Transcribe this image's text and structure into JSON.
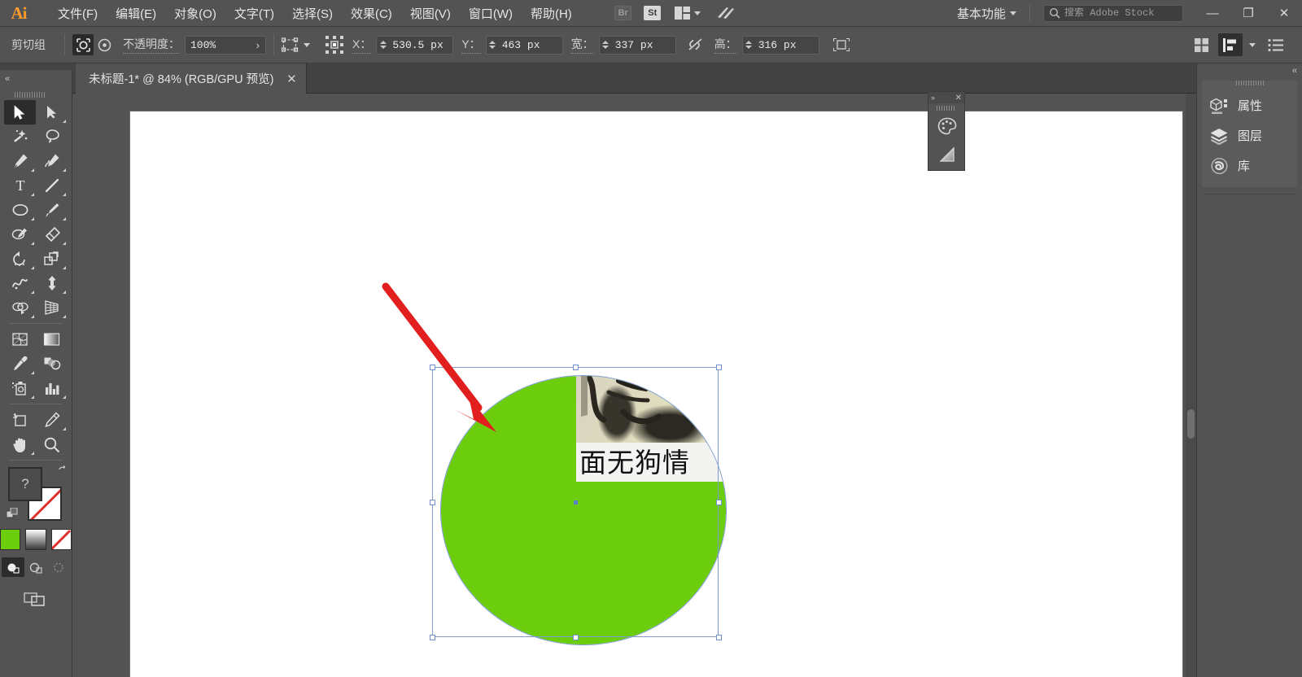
{
  "app": {
    "name": "Adobe Illustrator",
    "logo_text": "Ai"
  },
  "menubar": {
    "items": [
      {
        "label": "文件(F)",
        "name": "menu-file"
      },
      {
        "label": "编辑(E)",
        "name": "menu-edit"
      },
      {
        "label": "对象(O)",
        "name": "menu-object"
      },
      {
        "label": "文字(T)",
        "name": "menu-type"
      },
      {
        "label": "选择(S)",
        "name": "menu-select"
      },
      {
        "label": "效果(C)",
        "name": "menu-effect"
      },
      {
        "label": "视图(V)",
        "name": "menu-view"
      },
      {
        "label": "窗口(W)",
        "name": "menu-window"
      },
      {
        "label": "帮助(H)",
        "name": "menu-help"
      }
    ],
    "bridge_badge": "Br",
    "stock_badge": "St",
    "workspace": "基本功能",
    "search_placeholder": "搜索 Adobe Stock",
    "search_value": "",
    "window_minimize": "—",
    "window_restore": "❐",
    "window_close": "✕"
  },
  "controlbar": {
    "selection_label": "剪切组",
    "opacity_label": "不透明度：",
    "opacity_value": "100%",
    "opacity_arrow": "›",
    "x_label": "X：",
    "x_value": "530.5 px",
    "y_label": "Y：",
    "y_value": "463 px",
    "w_label": "宽：",
    "w_value": "337 px",
    "h_label": "高：",
    "h_value": "316 px",
    "link_state": "unlinked"
  },
  "tabbar": {
    "document_title": "未标题-1* @ 84% (RGB/GPU 预览)",
    "close_glyph": "✕"
  },
  "toolbar": {
    "collapse_glyph": "«",
    "tools": [
      {
        "name": "selection-tool",
        "label": "选择工具",
        "active": true,
        "corner": false
      },
      {
        "name": "direct-selection-tool",
        "label": "直接选择工具",
        "active": false,
        "corner": true
      },
      {
        "name": "magic-wand-tool",
        "label": "魔棒工具",
        "active": false,
        "corner": false
      },
      {
        "name": "lasso-tool",
        "label": "套索工具",
        "active": false,
        "corner": false
      },
      {
        "name": "pen-tool",
        "label": "钢笔工具",
        "active": false,
        "corner": true
      },
      {
        "name": "curvature-tool",
        "label": "曲率工具",
        "active": false,
        "corner": true
      },
      {
        "name": "type-tool",
        "label": "文字工具",
        "active": false,
        "corner": true
      },
      {
        "name": "line-segment-tool",
        "label": "直线段工具",
        "active": false,
        "corner": true
      },
      {
        "name": "ellipse-tool",
        "label": "椭圆工具",
        "active": false,
        "corner": true
      },
      {
        "name": "paintbrush-tool",
        "label": "画笔工具",
        "active": false,
        "corner": true
      },
      {
        "name": "pencil-tool",
        "label": "铅笔工具",
        "active": false,
        "corner": true
      },
      {
        "name": "eraser-tool",
        "label": "橡皮擦工具",
        "active": false,
        "corner": true
      },
      {
        "name": "rotate-tool",
        "label": "旋转工具",
        "active": false,
        "corner": true
      },
      {
        "name": "scale-tool",
        "label": "比例缩放工具",
        "active": false,
        "corner": true
      },
      {
        "name": "width-tool",
        "label": "宽度工具",
        "active": false,
        "corner": true
      },
      {
        "name": "free-transform-tool",
        "label": "自由变换工具",
        "active": false,
        "corner": true
      },
      {
        "name": "shape-builder-tool",
        "label": "形状生成器工具",
        "active": false,
        "corner": true
      },
      {
        "name": "perspective-grid-tool",
        "label": "透视网格工具",
        "active": false,
        "corner": true
      },
      {
        "name": "mesh-tool",
        "label": "网格工具",
        "active": false,
        "corner": false
      },
      {
        "name": "gradient-tool",
        "label": "渐变工具",
        "active": false,
        "corner": false
      },
      {
        "name": "eyedropper-tool",
        "label": "吸管工具",
        "active": false,
        "corner": true
      },
      {
        "name": "blend-tool",
        "label": "混合工具",
        "active": false,
        "corner": false
      },
      {
        "name": "symbol-sprayer-tool",
        "label": "符号喷枪工具",
        "active": false,
        "corner": true
      },
      {
        "name": "column-graph-tool",
        "label": "柱形图工具",
        "active": false,
        "corner": true
      },
      {
        "name": "artboard-tool",
        "label": "画板工具",
        "active": false,
        "corner": false
      },
      {
        "name": "slice-tool",
        "label": "切片工具",
        "active": false,
        "corner": true
      },
      {
        "name": "hand-tool",
        "label": "抓手工具",
        "active": false,
        "corner": true
      },
      {
        "name": "zoom-tool",
        "label": "缩放工具",
        "active": false,
        "corner": false
      }
    ],
    "fill_placeholder": "?",
    "fill_color": "#4b4b4b",
    "stroke_color": "#ffffff",
    "stroke_none": true,
    "color_swatches": [
      {
        "name": "color-swatch",
        "color": "#6ccd0c",
        "type": "solid"
      },
      {
        "name": "gradient-swatch",
        "color": "",
        "type": "gradient"
      },
      {
        "name": "none-swatch",
        "color": "",
        "type": "none"
      }
    ],
    "draw_modes": [
      {
        "name": "draw-normal-mode",
        "active": true
      },
      {
        "name": "draw-behind-mode",
        "active": false
      },
      {
        "name": "draw-inside-mode",
        "active": false
      }
    ]
  },
  "canvas": {
    "zoom": "84%",
    "artwork": {
      "shape": "circle",
      "fill_color": "#6ccd0c",
      "selected": true,
      "selection_color": "#7d9bd2",
      "embedded_image_caption": "面无狗情"
    },
    "annotation": {
      "type": "arrow",
      "color": "#e21f1f"
    }
  },
  "mini_panel": {
    "expand_glyph": "»",
    "close_glyph": "✕",
    "items": [
      {
        "name": "swatches-panel-icon",
        "label": "色板"
      },
      {
        "name": "gradient-panel-icon",
        "label": "渐变"
      }
    ]
  },
  "right_dock": {
    "collapse_glyph": "«",
    "items": [
      {
        "name": "panel-properties",
        "label": "属性",
        "icon": "properties-icon"
      },
      {
        "name": "panel-layers",
        "label": "图层",
        "icon": "layers-icon"
      },
      {
        "name": "panel-libraries",
        "label": "库",
        "icon": "libraries-icon"
      }
    ]
  }
}
